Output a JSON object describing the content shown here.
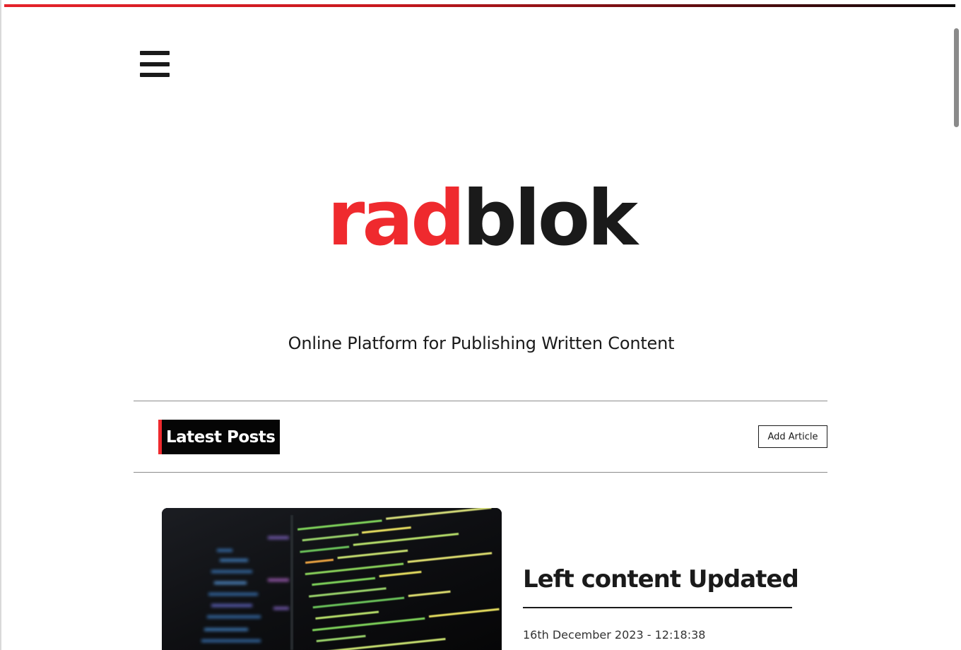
{
  "brand": {
    "logo_part1": "rad",
    "logo_part2": "blok",
    "tagline": "Online Platform for Publishing Written Content",
    "accent_color": "#ef2a2e",
    "dark_color": "#1a1a1a"
  },
  "header": {
    "menu_icon": "hamburger-menu-icon"
  },
  "section": {
    "title": "Latest Posts",
    "add_button_label": "Add Article"
  },
  "posts": [
    {
      "title": "Left content Updated",
      "date": "16th December 2023 - 12:18:38",
      "image_alt": "code-on-screen-image"
    }
  ]
}
